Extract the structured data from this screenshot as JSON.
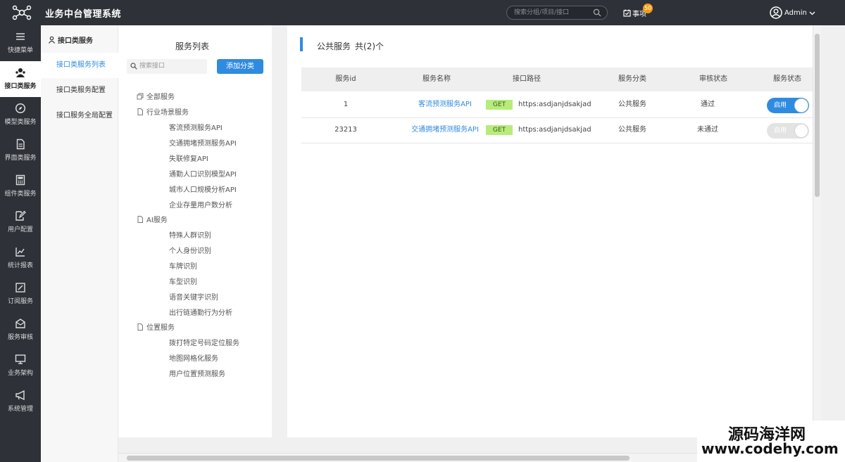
{
  "app": {
    "title": "业务中台管理系统"
  },
  "topbar": {
    "search_placeholder": "搜索分组/项目/接口",
    "todo_label": "事项",
    "todo_count": "50",
    "user_name": "Admin"
  },
  "sidebar": {
    "items": [
      {
        "label": "快捷菜单",
        "icon": "menu-icon"
      },
      {
        "label": "接口类服务",
        "icon": "users-icon"
      },
      {
        "label": "模型类服务",
        "icon": "compass-icon"
      },
      {
        "label": "界面类服务",
        "icon": "document-icon"
      },
      {
        "label": "组件类服务",
        "icon": "calculator-icon"
      },
      {
        "label": "用户配置",
        "icon": "edit-icon"
      },
      {
        "label": "统计报表",
        "icon": "chart-icon"
      },
      {
        "label": "订阅服务",
        "icon": "pencil-square-icon"
      },
      {
        "label": "服务审核",
        "icon": "mail-icon"
      },
      {
        "label": "业务架构",
        "icon": "monitor-icon"
      },
      {
        "label": "系统管理",
        "icon": "megaphone-icon"
      }
    ]
  },
  "subnav": {
    "header": "接口类服务",
    "items": [
      {
        "label": "接口类服务列表"
      },
      {
        "label": "接口类服务配置"
      },
      {
        "label": "接口服务全局配置"
      }
    ]
  },
  "service_panel": {
    "title": "服务列表",
    "search_placeholder": "搜索接口",
    "add_button": "添加分类",
    "all_label": "全部服务",
    "groups": [
      {
        "label": "行业场景服务",
        "children": [
          "客流预测服务API",
          "交通拥堵预测服务API",
          "失联修复API",
          "通勤人口识别模型API",
          "城市人口规模分析API",
          "企业存量用户数分析"
        ]
      },
      {
        "label": "AI服务",
        "children": [
          "特殊人群识别",
          "个人身份识别",
          "车牌识别",
          "车型识别",
          "语音关键字识别",
          "出行链通勤行为分析"
        ]
      },
      {
        "label": "位置服务",
        "children": [
          "拨打特定号码定位服务",
          "地图网格化服务",
          "用户位置预测服务"
        ]
      }
    ]
  },
  "main": {
    "title": "公共服务",
    "count": "共(2)个",
    "columns": [
      "服务id",
      "服务名称",
      "接口路径",
      "服务分类",
      "审核状态",
      "服务状态"
    ],
    "rows": [
      {
        "id": "1",
        "name": "客流预测服务API",
        "method": "GET",
        "path": "https:asdjanjdsakjad",
        "category": "公共服务",
        "review": "通过",
        "status": "启用",
        "enabled": true
      },
      {
        "id": "23213",
        "name": "交通拥堵预测服务API",
        "method": "GET",
        "path": "https:asdjanjdsakjad",
        "category": "公共服务",
        "review": "未通过",
        "status": "启用",
        "enabled": false
      }
    ]
  },
  "watermark": {
    "line1": "源码海洋网",
    "line2": "www.codehy.com"
  },
  "colors": {
    "accent": "#2f8be0",
    "sidebar_bg": "#2e3138",
    "method_bg": "#b7ec7b",
    "badge": "#f39c12"
  }
}
